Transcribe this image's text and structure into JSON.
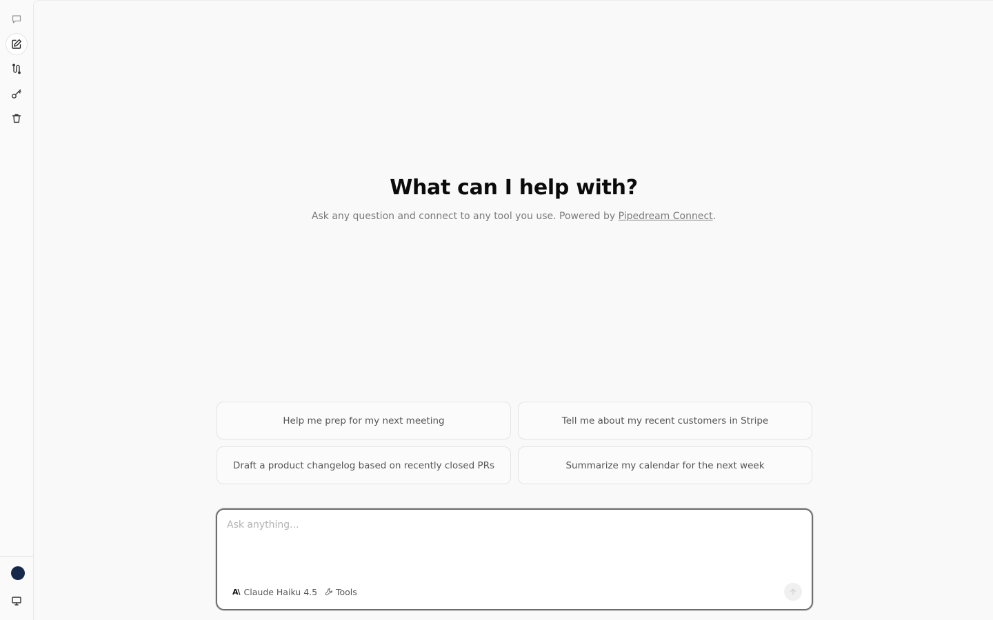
{
  "sidebar": {
    "items": [
      {
        "icon": "chat-bubble-icon"
      },
      {
        "icon": "new-chat-icon"
      },
      {
        "icon": "connections-icon"
      },
      {
        "icon": "key-icon"
      },
      {
        "icon": "trash-icon"
      }
    ],
    "bottom": [
      {
        "icon": "avatar"
      },
      {
        "icon": "monitor-icon"
      }
    ]
  },
  "hero": {
    "title": "What can I help with?",
    "subtitle_prefix": "Ask any question and connect to any tool you use. Powered by ",
    "subtitle_link": "Pipedream Connect",
    "subtitle_suffix": "."
  },
  "suggestions": [
    "Help me prep for my next meeting",
    "Tell me about my recent customers in Stripe",
    "Draft a product changelog based on recently closed PRs",
    "Summarize my calendar for the next week"
  ],
  "composer": {
    "placeholder": "Ask anything...",
    "model_label": "Claude Haiku 4.5",
    "model_logo": "A\\",
    "tools_label": "Tools"
  },
  "colors": {
    "background": "#f9f9f9",
    "avatar": "#17294a",
    "composer_border": "#6e6e6e"
  }
}
